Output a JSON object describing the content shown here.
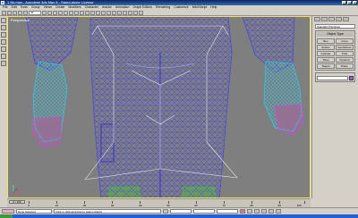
{
  "window": {
    "title": "1 Nk.max - Autodesk 3ds Max 8 - Stand-alone License",
    "minimize": "_",
    "maximize": "□",
    "close": "×"
  },
  "menu": [
    "File",
    "Edit",
    "Tools",
    "Group",
    "Views",
    "Create",
    "Modifiers",
    "Character",
    "reactor",
    "Animation",
    "Graph Editors",
    "Rendering",
    "Customize",
    "MAXScript",
    "Help"
  ],
  "toolbar": {
    "selection_filter": "All"
  },
  "viewport": {
    "label": "Perspective"
  },
  "command_panel": {
    "rollout_title": "Object Type",
    "dropdown": "Standard Primitives",
    "buttons": [
      "Box",
      "Cone",
      "Sphere",
      "GeoSphere",
      "Cylinder",
      "Tube",
      "Torus",
      "Pyramid",
      "Teapot",
      "Plane"
    ],
    "swatch_color": "#8f5fd0"
  },
  "timeline": {
    "slider_label": "0 / 100",
    "ticks": [
      "0",
      "10",
      "20",
      "30",
      "40",
      "50",
      "60",
      "70",
      "80",
      "90",
      "100"
    ]
  },
  "statusbar": {
    "selected": "None Selected",
    "prompt": "Click or click-and-drag to select objects"
  },
  "colors": {
    "viewport_bg": "#7f7f7f",
    "wire_blue": "#4a4ad8",
    "wire_cyan": "#2ec8e8",
    "wire_magenta": "#d04ad0",
    "wire_green": "#3fbf3f",
    "active_border": "#f3e45a"
  }
}
